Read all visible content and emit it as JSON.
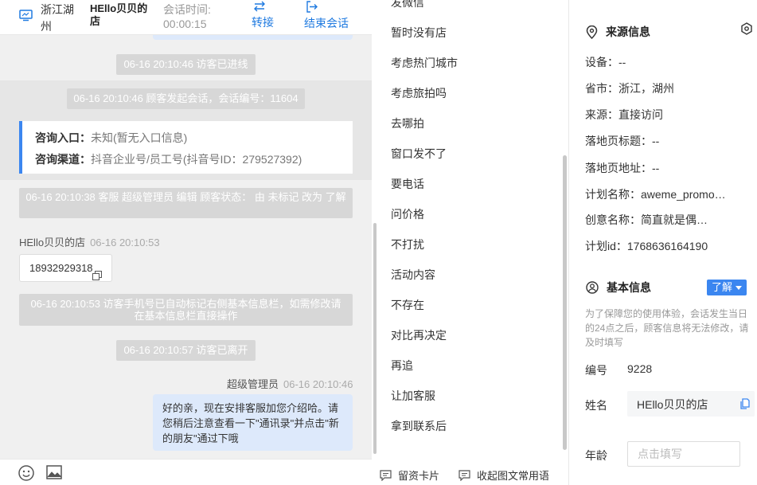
{
  "chat": {
    "header": {
      "region": "浙江湖州",
      "store": "HEllo贝贝的店",
      "time_label": "会话时间:",
      "time_value": "00:00:15",
      "transfer_label": "转接",
      "end_label": "结束会话"
    },
    "messages": {
      "visitor_entered": "06-16 20:10:46 访客已进线",
      "session_started": "06-16 20:10:46 顾客发起会话，会话编号：11604",
      "entry_label": "咨询入口：",
      "entry_value": "未知(暂无入口信息)",
      "channel_label": "咨询渠道：",
      "channel_value": "抖音企业号/员工号(抖音号ID：279527392)",
      "status_edit": "06-16 20:10:38 客服 超级管理员 编辑 顾客状态： 由 未标记 改为 了解",
      "customer_name": "HEllo贝贝的店",
      "customer_time": "06-16 20:10:53",
      "phone": "18932929318",
      "phone_tagged": "06-16 20:10:53 访客手机号已自动标记右侧基本信息栏，如需修改请在基本信息栏直接操作",
      "visitor_left": "06-16 20:10:57 访客已离开",
      "agent_name": "超级管理员",
      "agent_time": "06-16 20:10:46",
      "agent_text": "好的亲，现在安排客服加您介绍哈。请您稍后注意查看一下\"通讯录\"并点击\"新的朋友\"通过下哦"
    }
  },
  "phrases": {
    "items": [
      "发微信",
      "暂时没有店",
      "考虑热门城市",
      "考虑旅拍吗",
      "去哪拍",
      "窗口发不了",
      "要电话",
      "问价格",
      "不打扰",
      "活动内容",
      "不存在",
      "对比再决定",
      "再追",
      "让加客服",
      "拿到联系后"
    ],
    "footer": {
      "card_label": "留资卡片",
      "collapse_label": "收起图文常用语"
    }
  },
  "info": {
    "source": {
      "title": "来源信息",
      "rows": [
        "设备：--",
        "省市：浙江，湖州",
        "来源：直接访问",
        "落地页标题：--",
        "落地页地址：--",
        "计划名称：aweme_promotion",
        "创意名称：简直就是偶像剧",
        "计划id：1768636164190"
      ]
    },
    "basic": {
      "title": "基本信息",
      "status_button": "了解",
      "notice": "为了保障您的使用体验，会话发生当日的24点之后，顾客信息将无法修改，请及时填写",
      "id_label": "编号",
      "id_value": "9228",
      "name_label": "姓名",
      "name_value": "HEllo贝贝的店",
      "age_label": "年龄",
      "age_placeholder": "点击填写"
    }
  },
  "colors": {
    "accent": "#3b86f0",
    "link": "#1f7ae0",
    "agent_bubble": "#dde9fb",
    "system_pill": "#d7d7d7"
  }
}
